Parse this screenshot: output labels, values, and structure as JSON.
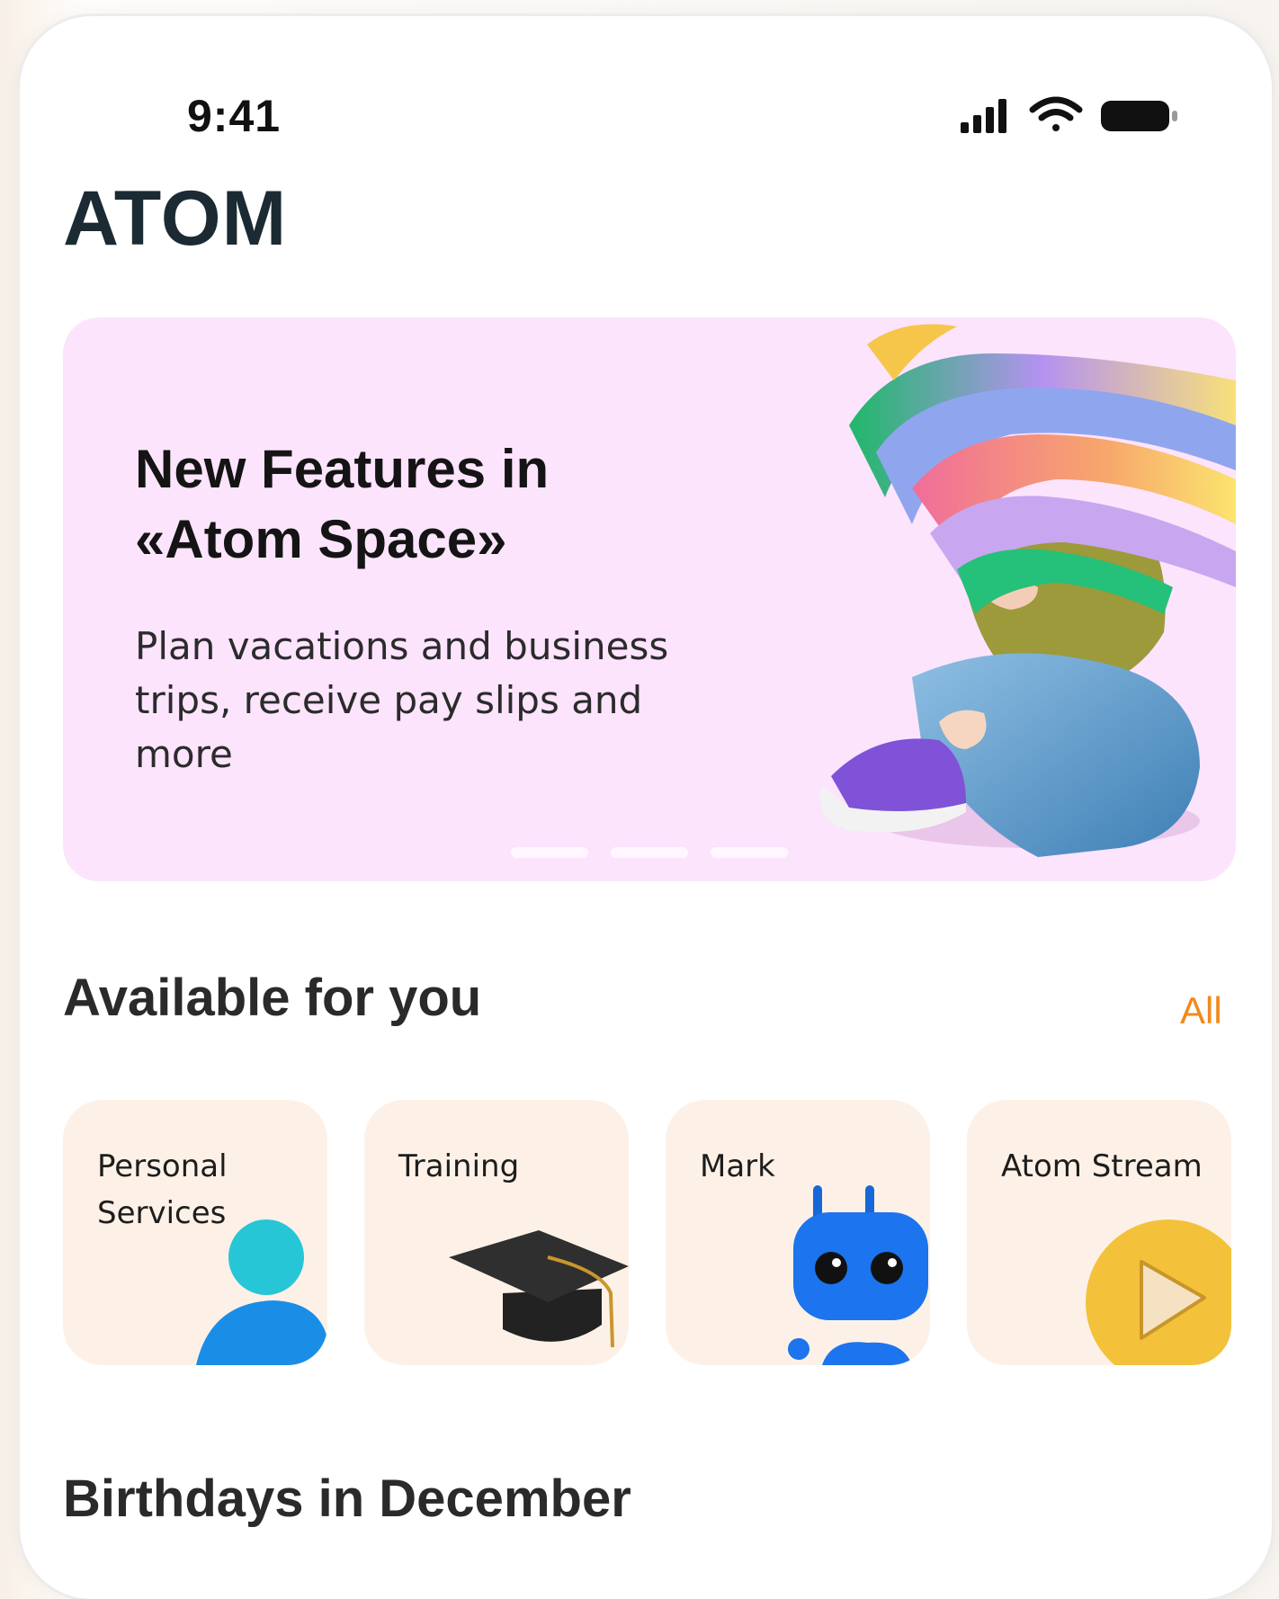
{
  "status_bar": {
    "time": "9:41",
    "icons": [
      "signal-icon",
      "wifi-icon",
      "battery-icon"
    ]
  },
  "brand": {
    "logo_text": "ATOM",
    "color": "#1b2a33"
  },
  "banner": {
    "title_line1": "New Features in",
    "title_line2": "«Atom Space»",
    "subtitle": "Plan vacations and business trips, receive pay slips and more",
    "background": "#fce4fd",
    "pages": 3
  },
  "available": {
    "title": "Available for you",
    "all_label": "All",
    "accent": "#f08a1c",
    "cards": [
      {
        "label": "Personal Services",
        "icon": "person-icon"
      },
      {
        "label": "Training",
        "icon": "graduation-cap-icon"
      },
      {
        "label": "Mark",
        "icon": "robot-icon"
      },
      {
        "label": "Atom Stream",
        "icon": "play-icon"
      }
    ]
  },
  "birthdays": {
    "title": "Birthdays in December"
  }
}
